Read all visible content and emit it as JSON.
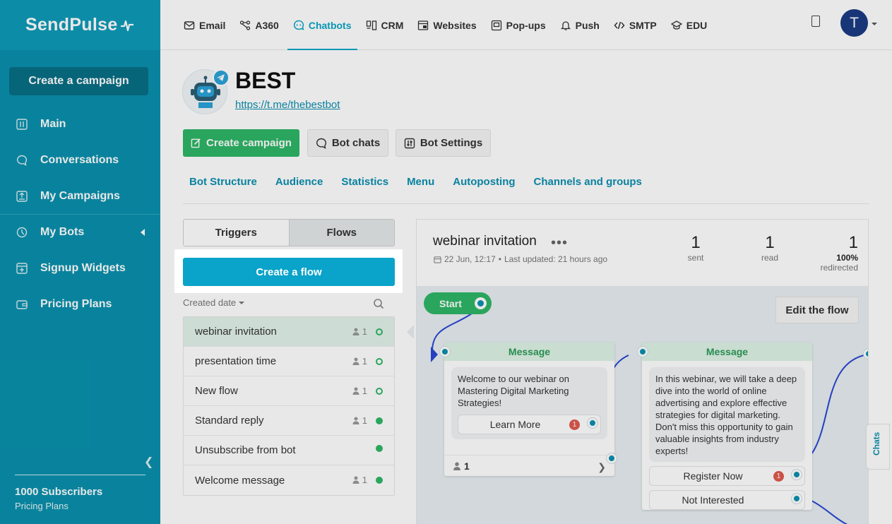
{
  "sidebar": {
    "logo": "SendPulse",
    "create_campaign": "Create a campaign",
    "items": [
      {
        "label": "Main",
        "icon": "main-icon"
      },
      {
        "label": "Conversations",
        "icon": "chat-icon"
      },
      {
        "label": "My Campaigns",
        "icon": "campaigns-icon"
      },
      {
        "label": "My Bots",
        "icon": "bots-icon"
      },
      {
        "label": "Signup Widgets",
        "icon": "widgets-icon"
      },
      {
        "label": "Pricing Plans",
        "icon": "wallet-icon"
      }
    ],
    "subscribers": "1000 Subscribers",
    "pricing_link": "Pricing Plans"
  },
  "topnav": {
    "items": [
      {
        "label": "Email",
        "icon": "email-icon"
      },
      {
        "label": "A360",
        "icon": "a360-icon"
      },
      {
        "label": "Chatbots",
        "icon": "chatbot-icon"
      },
      {
        "label": "CRM",
        "icon": "crm-icon"
      },
      {
        "label": "Websites",
        "icon": "websites-icon"
      },
      {
        "label": "Pop-ups",
        "icon": "popups-icon"
      },
      {
        "label": "Push",
        "icon": "bell-icon"
      },
      {
        "label": "SMTP",
        "icon": "code-icon"
      },
      {
        "label": "EDU",
        "icon": "edu-icon"
      }
    ],
    "active": "Chatbots",
    "avatar_initial": "T"
  },
  "bot": {
    "name": "BEST",
    "link": "https://t.me/thebestbot"
  },
  "actions": {
    "create_campaign": "Create campaign",
    "bot_chats": "Bot chats",
    "bot_settings": "Bot Settings"
  },
  "subtabs": [
    "Bot Structure",
    "Audience",
    "Statistics",
    "Menu",
    "Autoposting",
    "Channels and groups"
  ],
  "left_panel": {
    "triggers_tab": "Triggers",
    "flows_tab": "Flows",
    "create_flow": "Create a flow",
    "sort_label": "Created date",
    "flows": [
      {
        "name": "webinar invitation",
        "count": "1",
        "status": "outline"
      },
      {
        "name": "presentation time",
        "count": "1",
        "status": "outline"
      },
      {
        "name": "New flow",
        "count": "1",
        "status": "outline"
      },
      {
        "name": "Standard reply",
        "count": "1",
        "status": "solid"
      },
      {
        "name": "Unsubscribe from bot",
        "count": "",
        "status": "solid"
      },
      {
        "name": "Welcome message",
        "count": "1",
        "status": "solid"
      }
    ]
  },
  "flow": {
    "title": "webinar invitation",
    "date": "22 Jun, 12:17",
    "updated": "Last updated: 21 hours ago",
    "stats": {
      "sent_value": "1",
      "sent_label": "sent",
      "read_value": "1",
      "read_label": "read",
      "redirected_value": "1",
      "redirected_pct": "100%",
      "redirected_label": "redirected"
    },
    "start_label": "Start",
    "edit_label": "Edit the flow",
    "cards": [
      {
        "header": "Message",
        "text": "Welcome to our webinar on Mastering Digital Marketing Strategies!",
        "buttons": [
          {
            "label": "Learn More",
            "badge": "1"
          }
        ],
        "footer_count": "1"
      },
      {
        "header": "Message",
        "text": "In this webinar, we will take a deep dive into the world of online advertising and explore effective strategies for digital marketing. Don't miss this opportunity to gain valuable insights from industry experts!",
        "buttons": [
          {
            "label": "Register Now",
            "badge": "1"
          },
          {
            "label": "Not Interested",
            "badge": ""
          }
        ]
      }
    ]
  },
  "chats_tab": "Chats"
}
